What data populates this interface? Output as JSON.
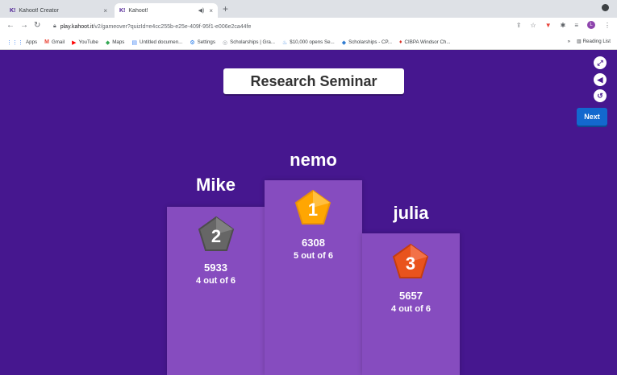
{
  "browser": {
    "tabs": [
      {
        "favicon": "K!",
        "title": "Kahoot! Creator",
        "close": "×"
      },
      {
        "favicon": "K!",
        "title": "Kahoot!",
        "close": "×"
      }
    ],
    "new_tab": "+",
    "url_host": "play.kahoot.it",
    "url_path": "/v2/gameover?quizId=e4cc255b-e25e-409f-95f1-e006e2ca44fe",
    "bookmarks": [
      "Apps",
      "Gmail",
      "YouTube",
      "Maps",
      "Untitled documen...",
      "Settings",
      "Scholarships | Gra...",
      "$10,000 opens Se...",
      "Scholarships - CP...",
      "CIBPA Windsor Ch..."
    ],
    "bookmark_more": "»",
    "reading_list": "Reading List",
    "profile_initial": "L"
  },
  "game": {
    "title": "Research Seminar",
    "next_label": "Next",
    "podium": [
      {
        "place": "2",
        "name": "Mike",
        "score": "5933",
        "correct": "4 out of 6",
        "medal_color": "#666666"
      },
      {
        "place": "1",
        "name": "nemo",
        "score": "6308",
        "correct": "5 out of 6",
        "medal_color": "#ffa602"
      },
      {
        "place": "3",
        "name": "julia",
        "score": "5657",
        "correct": "4 out of 6",
        "medal_color": "#e9531d"
      }
    ]
  },
  "colors": {
    "background": "#46178f",
    "podium": "#864cbf",
    "next_button": "#1368ce"
  }
}
